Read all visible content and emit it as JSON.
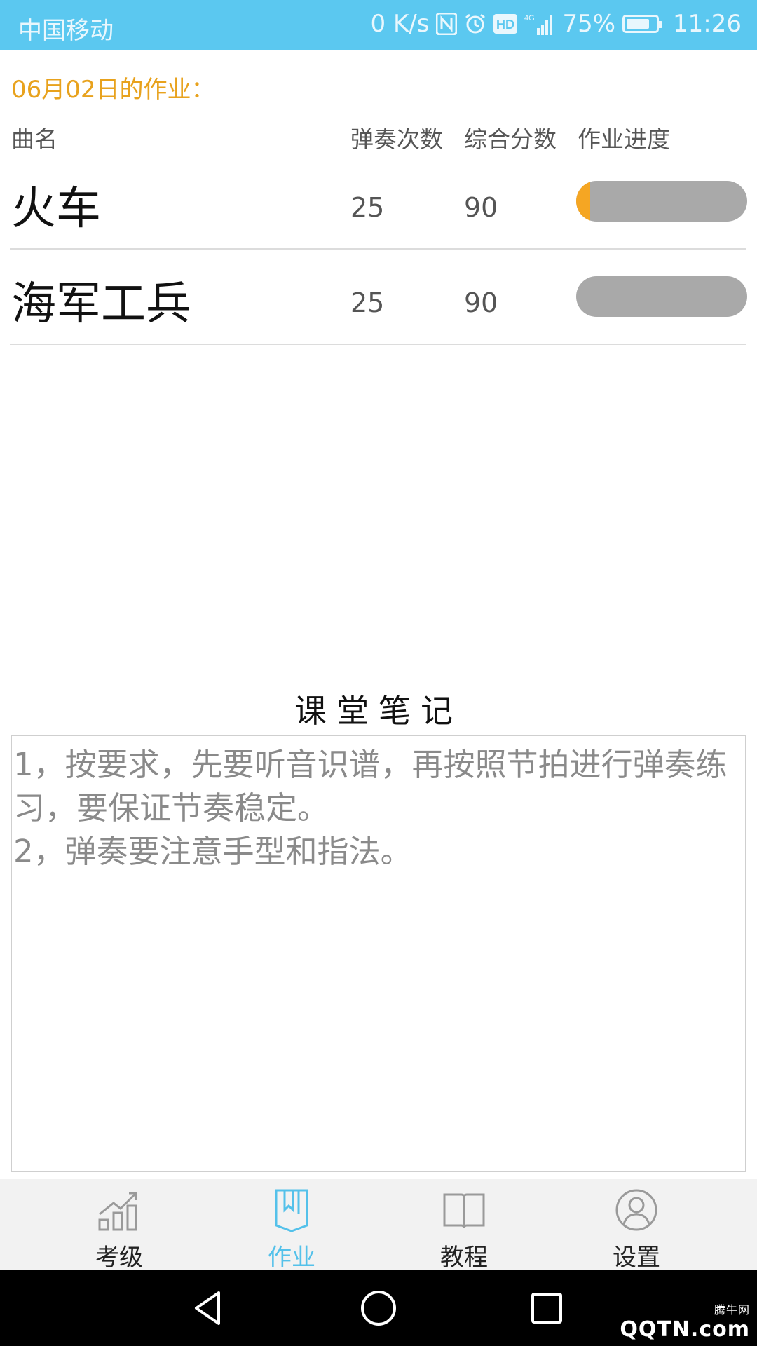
{
  "status_bar": {
    "carrier": "中国移动",
    "speed": "0 K/s",
    "nfc": "N",
    "hd": "HD",
    "network": "4G",
    "battery": "75%",
    "time": "11:26",
    "icons": [
      "nfc-icon",
      "alarm-icon",
      "hd-icon",
      "signal-icon",
      "battery-icon"
    ]
  },
  "homework": {
    "title": "06月02日的作业：",
    "columns": {
      "name": "曲名",
      "plays": "弹奏次数",
      "score": "综合分数",
      "progress": "作业进度"
    },
    "rows": [
      {
        "name": "火车",
        "plays": "25",
        "score": "90",
        "progress": 0.08
      },
      {
        "name": "海军工兵",
        "plays": "25",
        "score": "90",
        "progress": 0.0
      }
    ]
  },
  "notes": {
    "title": "课堂笔记",
    "text": "1，按要求，先要听音识谱，再按照节拍进行弹奏练习，要保证节奏稳定。\n2，弹奏要注意手型和指法。"
  },
  "bottom_nav": {
    "items": [
      {
        "label": "考级",
        "icon": "chart-growth-icon",
        "active": false
      },
      {
        "label": "作业",
        "icon": "bookmark-book-icon",
        "active": true
      },
      {
        "label": "教程",
        "icon": "open-book-icon",
        "active": false
      },
      {
        "label": "设置",
        "icon": "user-circle-icon",
        "active": false
      }
    ]
  },
  "system_nav": {
    "watermark": "QQTN.com",
    "watermark_sub": "腾牛网"
  },
  "colors": {
    "status_bar": "#5bc8f0",
    "accent": "#54c1ea",
    "date_title": "#e8a21d",
    "progress_fill": "#f5a623",
    "progress_track": "#a9a9a9"
  }
}
